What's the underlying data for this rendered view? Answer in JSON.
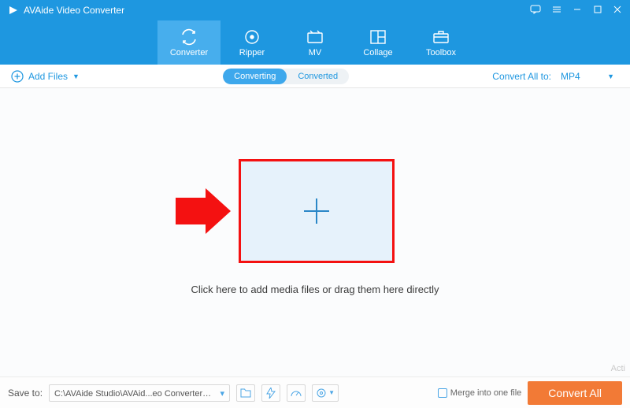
{
  "app": {
    "title": "AVAide Video Converter"
  },
  "nav": {
    "items": [
      {
        "label": "Converter"
      },
      {
        "label": "Ripper"
      },
      {
        "label": "MV"
      },
      {
        "label": "Collage"
      },
      {
        "label": "Toolbox"
      }
    ],
    "selected": 0
  },
  "toolbar": {
    "add_files_label": "Add Files",
    "tabs": {
      "converting": "Converting",
      "converted": "Converted"
    },
    "convert_all_to_label": "Convert All to:",
    "convert_all_to_value": "MP4"
  },
  "main": {
    "hint": "Click here to add media files or drag them here directly"
  },
  "footer": {
    "save_to_label": "Save to:",
    "save_to_path": "C:\\AVAide Studio\\AVAid...eo Converter\\Converted",
    "merge_label": "Merge into one file",
    "convert_all_label": "Convert All"
  },
  "watermark": "Acti"
}
